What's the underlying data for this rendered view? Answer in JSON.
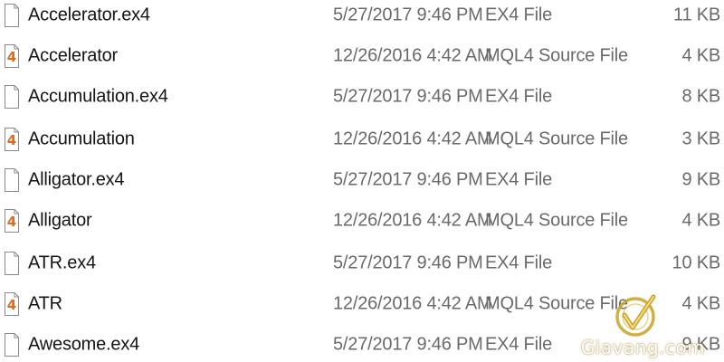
{
  "files": [
    {
      "name": "Accelerator.ex4",
      "date": "5/27/2017 9:46 PM",
      "type": "EX4 File",
      "size": "11 KB",
      "icon": "blank-file-icon"
    },
    {
      "name": "Accelerator",
      "date": "12/26/2016 4:42 AM",
      "type": "MQL4 Source File",
      "size": "4 KB",
      "icon": "mql4-file-icon"
    },
    {
      "name": "Accumulation.ex4",
      "date": "5/27/2017 9:46 PM",
      "type": "EX4 File",
      "size": "8 KB",
      "icon": "blank-file-icon"
    },
    {
      "name": "Accumulation",
      "date": "12/26/2016 4:42 AM",
      "type": "MQL4 Source File",
      "size": "3 KB",
      "icon": "mql4-file-icon"
    },
    {
      "name": "Alligator.ex4",
      "date": "5/27/2017 9:46 PM",
      "type": "EX4 File",
      "size": "9 KB",
      "icon": "blank-file-icon"
    },
    {
      "name": "Alligator",
      "date": "12/26/2016 4:42 AM",
      "type": "MQL4 Source File",
      "size": "4 KB",
      "icon": "mql4-file-icon"
    },
    {
      "name": "ATR.ex4",
      "date": "5/27/2017 9:46 PM",
      "type": "EX4 File",
      "size": "10 KB",
      "icon": "blank-file-icon"
    },
    {
      "name": "ATR",
      "date": "12/26/2016 4:42 AM",
      "type": "MQL4 Source File",
      "size": "4 KB",
      "icon": "mql4-file-icon"
    },
    {
      "name": "Awesome.ex4",
      "date": "5/27/2017 9:46 PM",
      "type": "EX4 File",
      "size": "9 KB",
      "icon": "blank-file-icon"
    }
  ],
  "mql4_icon_glyph": "4",
  "watermark": {
    "text": "Giavang.com",
    "icon": "giavang-logo-icon"
  },
  "colors": {
    "mql4_icon": "#e06a1f",
    "logo_gold": "#c9a227"
  }
}
